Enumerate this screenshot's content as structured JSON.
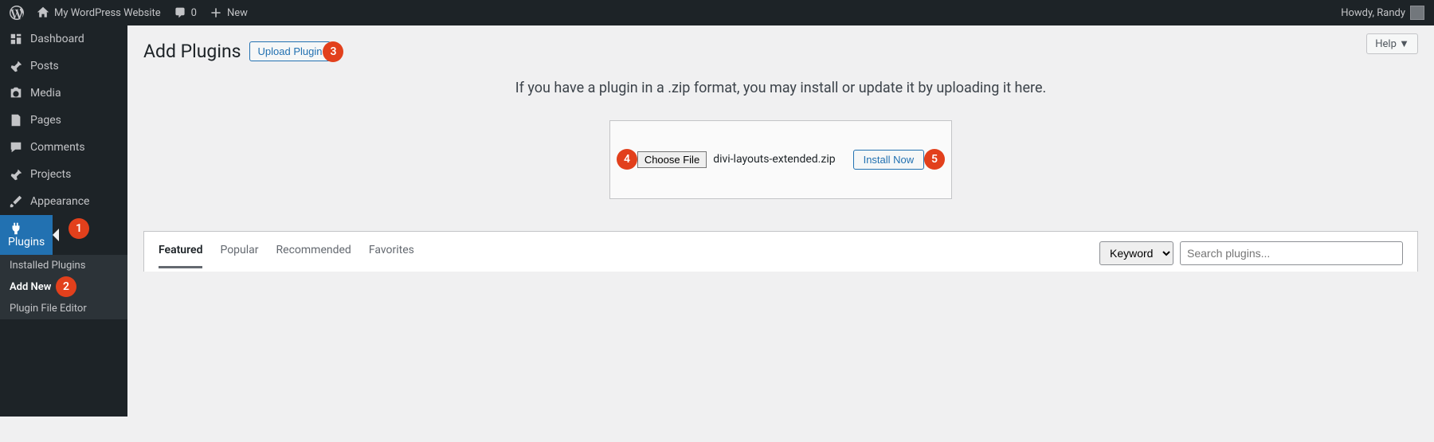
{
  "adminbar": {
    "site_name": "My WordPress Website",
    "comments": "0",
    "new_label": "New",
    "greeting": "Howdy, Randy"
  },
  "sidebar": {
    "items": [
      {
        "label": "Dashboard"
      },
      {
        "label": "Posts"
      },
      {
        "label": "Media"
      },
      {
        "label": "Pages"
      },
      {
        "label": "Comments"
      },
      {
        "label": "Projects"
      },
      {
        "label": "Appearance"
      },
      {
        "label": "Plugins"
      }
    ],
    "submenu": [
      {
        "label": "Installed Plugins"
      },
      {
        "label": "Add New"
      },
      {
        "label": "Plugin File Editor"
      }
    ]
  },
  "page": {
    "help": "Help",
    "title": "Add Plugins",
    "upload_button": "Upload Plugin",
    "upload_message": "If you have a plugin in a .zip format, you may install or update it by uploading it here.",
    "choose_file": "Choose File",
    "file_name": "divi-layouts-extended.zip",
    "install_now": "Install Now"
  },
  "filter": {
    "tabs": [
      "Featured",
      "Popular",
      "Recommended",
      "Favorites"
    ],
    "search_type": "Keyword",
    "search_placeholder": "Search plugins..."
  },
  "badges": [
    "1",
    "2",
    "3",
    "4",
    "5"
  ]
}
